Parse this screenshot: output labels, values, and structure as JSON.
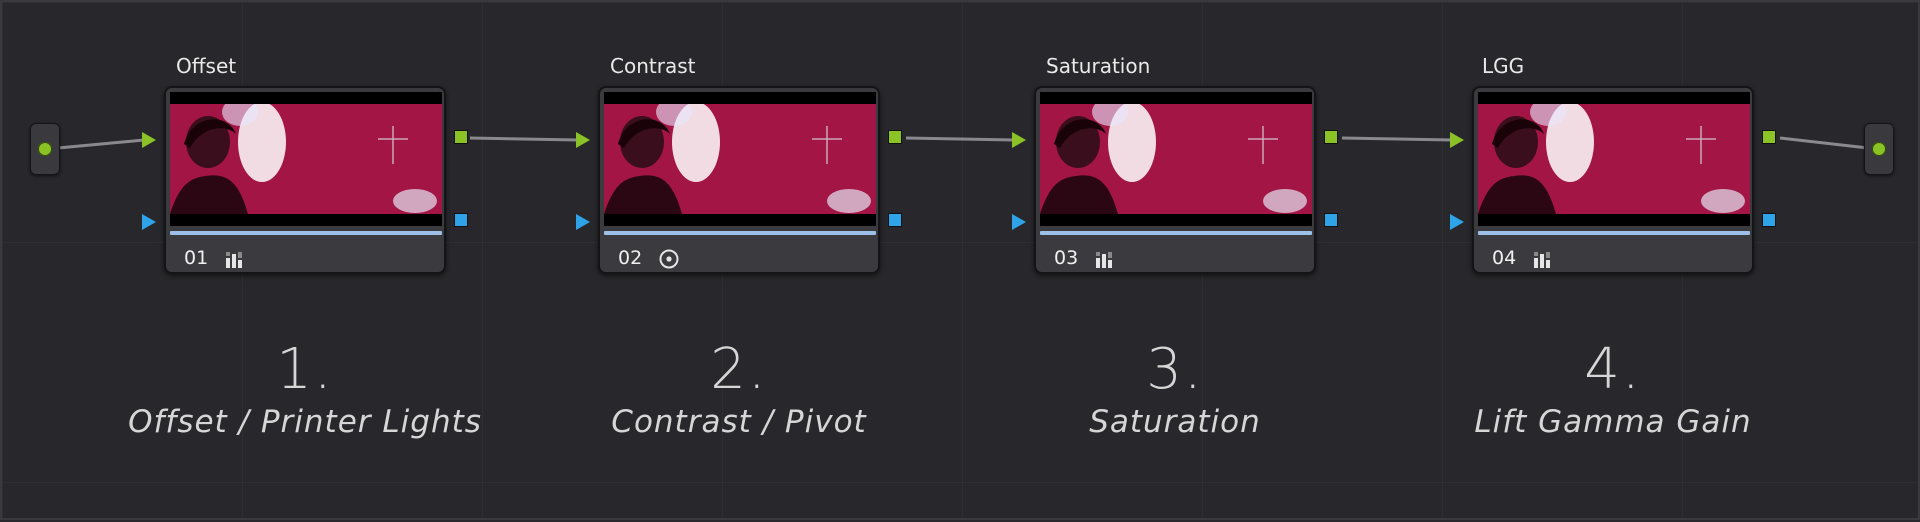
{
  "nodes": [
    {
      "title": "Offset",
      "number": "01",
      "icon": "histogram-icon"
    },
    {
      "title": "Contrast",
      "number": "02",
      "icon": "circle-dot-icon"
    },
    {
      "title": "Saturation",
      "number": "03",
      "icon": "histogram-icon"
    },
    {
      "title": "LGG",
      "number": "04",
      "icon": "histogram-icon"
    }
  ],
  "captions": [
    {
      "step": "1.",
      "label": "Offset / Printer Lights"
    },
    {
      "step": "2.",
      "label": "Contrast / Pivot"
    },
    {
      "step": "3.",
      "label": "Saturation"
    },
    {
      "step": "4.",
      "label": "Lift Gamma Gain"
    }
  ],
  "colors": {
    "background": "#28282c",
    "rgb_port": "#8bc225",
    "key_port": "#2ea3e8",
    "node_bar": "#9cc0e8"
  }
}
